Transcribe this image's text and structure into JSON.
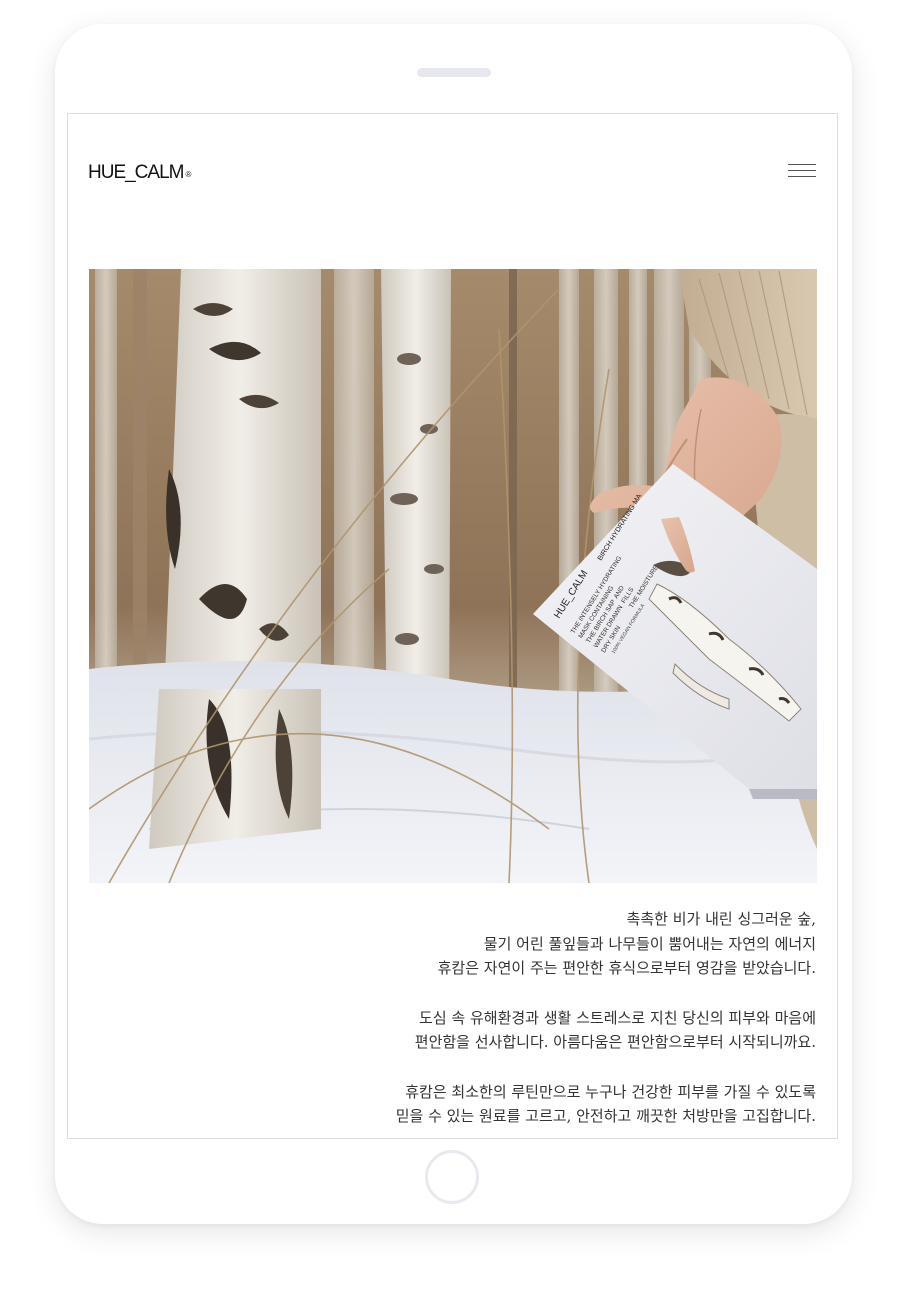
{
  "brand": {
    "logo_text": "HUE_CALM",
    "logo_mark": "®"
  },
  "header": {
    "menu_icon": "hamburger-menu-icon"
  },
  "hero": {
    "image_subject": "hand holding birch hydrating mask box in snowy birch forest",
    "box_brand": "HUE_CALM",
    "box_title": "BIRCH HYDRATING MA",
    "box_lines": [
      "THE INTENSELY HYDRATING",
      "MASK CONTAINING",
      "THE BIRCH SAP",
      "WATER DRAWN",
      "DRY SKIN"
    ],
    "box_lines_right": [
      "AND",
      "FILLS",
      "THE MOISTURE"
    ],
    "box_footnote": "100% VEGAN FORMULA"
  },
  "copy": {
    "paragraphs": [
      {
        "lines": [
          "촉촉한 비가 내린 싱그러운 숲,",
          "물기 어린 풀잎들과 나무들이 뿜어내는 자연의 에너지",
          "휴캄은 자연이 주는 편안한 휴식으로부터 영감을 받았습니다."
        ]
      },
      {
        "lines": [
          "도심 속 유해환경과 생활 스트레스로 지친 당신의 피부와 마음에",
          "편안함을 선사합니다. 아름다움은 편안함으로부터 시작되니까요."
        ]
      },
      {
        "lines": [
          "휴캄은 최소한의 루틴만으로 누구나 건강한 피부를 가질 수 있도록",
          "믿을 수 있는 원료를 고르고, 안전하고 깨끗한 처방만을 고집합니다."
        ]
      }
    ]
  },
  "colors": {
    "device_bezel": "#ffffff",
    "screen_border": "#dcdcdc",
    "text": "#333333",
    "snow": "#eef0f5",
    "birch_bark": "#e8e4dc",
    "forest_bg": "#a89277",
    "sweater": "#cbb79d"
  }
}
